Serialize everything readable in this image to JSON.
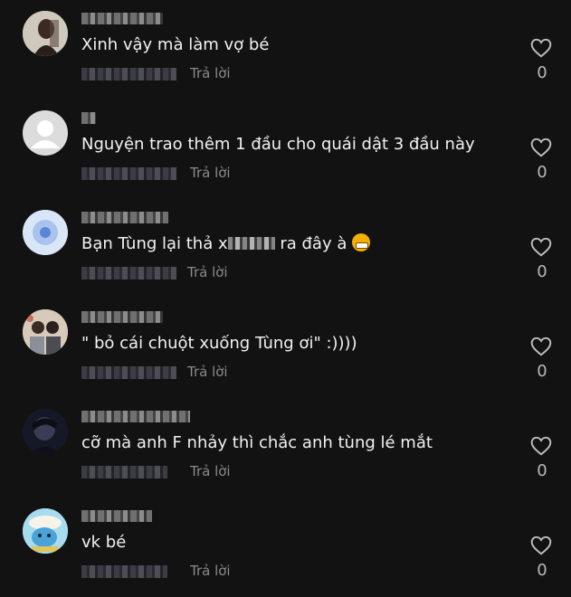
{
  "comments": [
    {
      "text": "Xinh vậy mà làm vợ bé",
      "reply": "Trả lời",
      "likes": "0",
      "avatar_icon": "avatar-photo-person"
    },
    {
      "text": "Nguyện trao thêm 1 đầu cho quái dật 3 đầu này",
      "reply": "Trả lời",
      "likes": "0",
      "avatar_icon": "default-avatar-icon"
    },
    {
      "text_before": "Bạn Tùng lại thả x",
      "text_after": " ra đây à",
      "reply": "Trả lời",
      "likes": "0",
      "avatar_icon": "blue-circle-avatar"
    },
    {
      "text": "\" bỏ cái chuột xuống Tùng ơi\" :))))",
      "reply": "Trả lời",
      "likes": "0",
      "avatar_icon": "avatar-photo-couple"
    },
    {
      "text": "cỡ mà anh F nhảy thì chắc anh tùng lé mắt",
      "reply": "Trả lời",
      "likes": "0",
      "avatar_icon": "avatar-photo-dark"
    },
    {
      "text": "vk bé",
      "reply": "Trả lời",
      "likes": "0",
      "avatar_icon": "avatar-cartoon-cloud"
    }
  ]
}
